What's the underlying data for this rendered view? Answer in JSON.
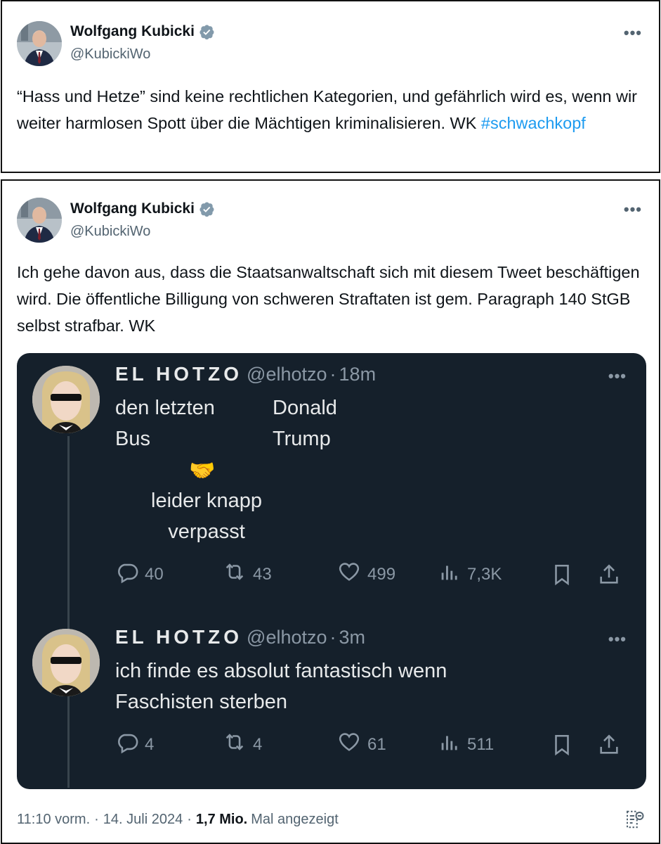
{
  "tweet1": {
    "author_name": "Wolfgang Kubicki",
    "author_handle": "@KubickiWo",
    "more_label": "•••",
    "text": "“Hass und Hetze” sind keine rechtlichen Kategorien, und gefährlich wird es, wenn wir weiter harmlosen Spott über die Mächtigen kriminalisieren. WK ",
    "hashtag": "#schwachkopf"
  },
  "tweet2": {
    "author_name": "Wolfgang Kubicki",
    "author_handle": "@KubickiWo",
    "more_label": "•••",
    "text": "Ich gehe davon aus, dass die Staatsanwaltschaft sich mit diesem Tweet beschäftigen wird. Die öffentliche Billigung von schweren Straftaten ist gem. Paragraph 140 StGB selbst strafbar. WK",
    "footer": {
      "time": "11:10 vorm.",
      "sep1": "·",
      "date": "14. Juli 2024",
      "sep2": "·",
      "views": "1,7 Mio.",
      "views_label": "Mal angezeigt"
    }
  },
  "quoted": {
    "post1": {
      "name": "EL HOTZO",
      "handle": "@elhotzo",
      "dot": "·",
      "time": "18m",
      "more_label": "•••",
      "left_text_1": "den letzten",
      "left_text_2": "Bus",
      "right_text_1": "Donald",
      "right_text_2": "Trump",
      "emoji": "🤝",
      "caption_1": "leider knapp",
      "caption_2": "verpasst",
      "replies": "40",
      "reposts": "43",
      "likes": "499",
      "views": "7,3K"
    },
    "post2": {
      "name": "EL HOTZO",
      "handle": "@elhotzo",
      "dot": "·",
      "time": "3m",
      "more_label": "•••",
      "text_1": "ich finde es absolut fantastisch wenn",
      "text_2": "Faschisten sterben",
      "replies": "4",
      "reposts": "4",
      "likes": "61",
      "views": "511"
    }
  },
  "colors": {
    "accent": "#1d9bf0",
    "dark_bg": "#15202b",
    "muted": "#536471",
    "dark_muted": "#8b98a5"
  },
  "icons": [
    "verified-badge-icon",
    "more-icon",
    "reply-icon",
    "repost-icon",
    "like-icon",
    "views-icon",
    "bookmark-icon",
    "share-icon",
    "analytics-icon"
  ]
}
